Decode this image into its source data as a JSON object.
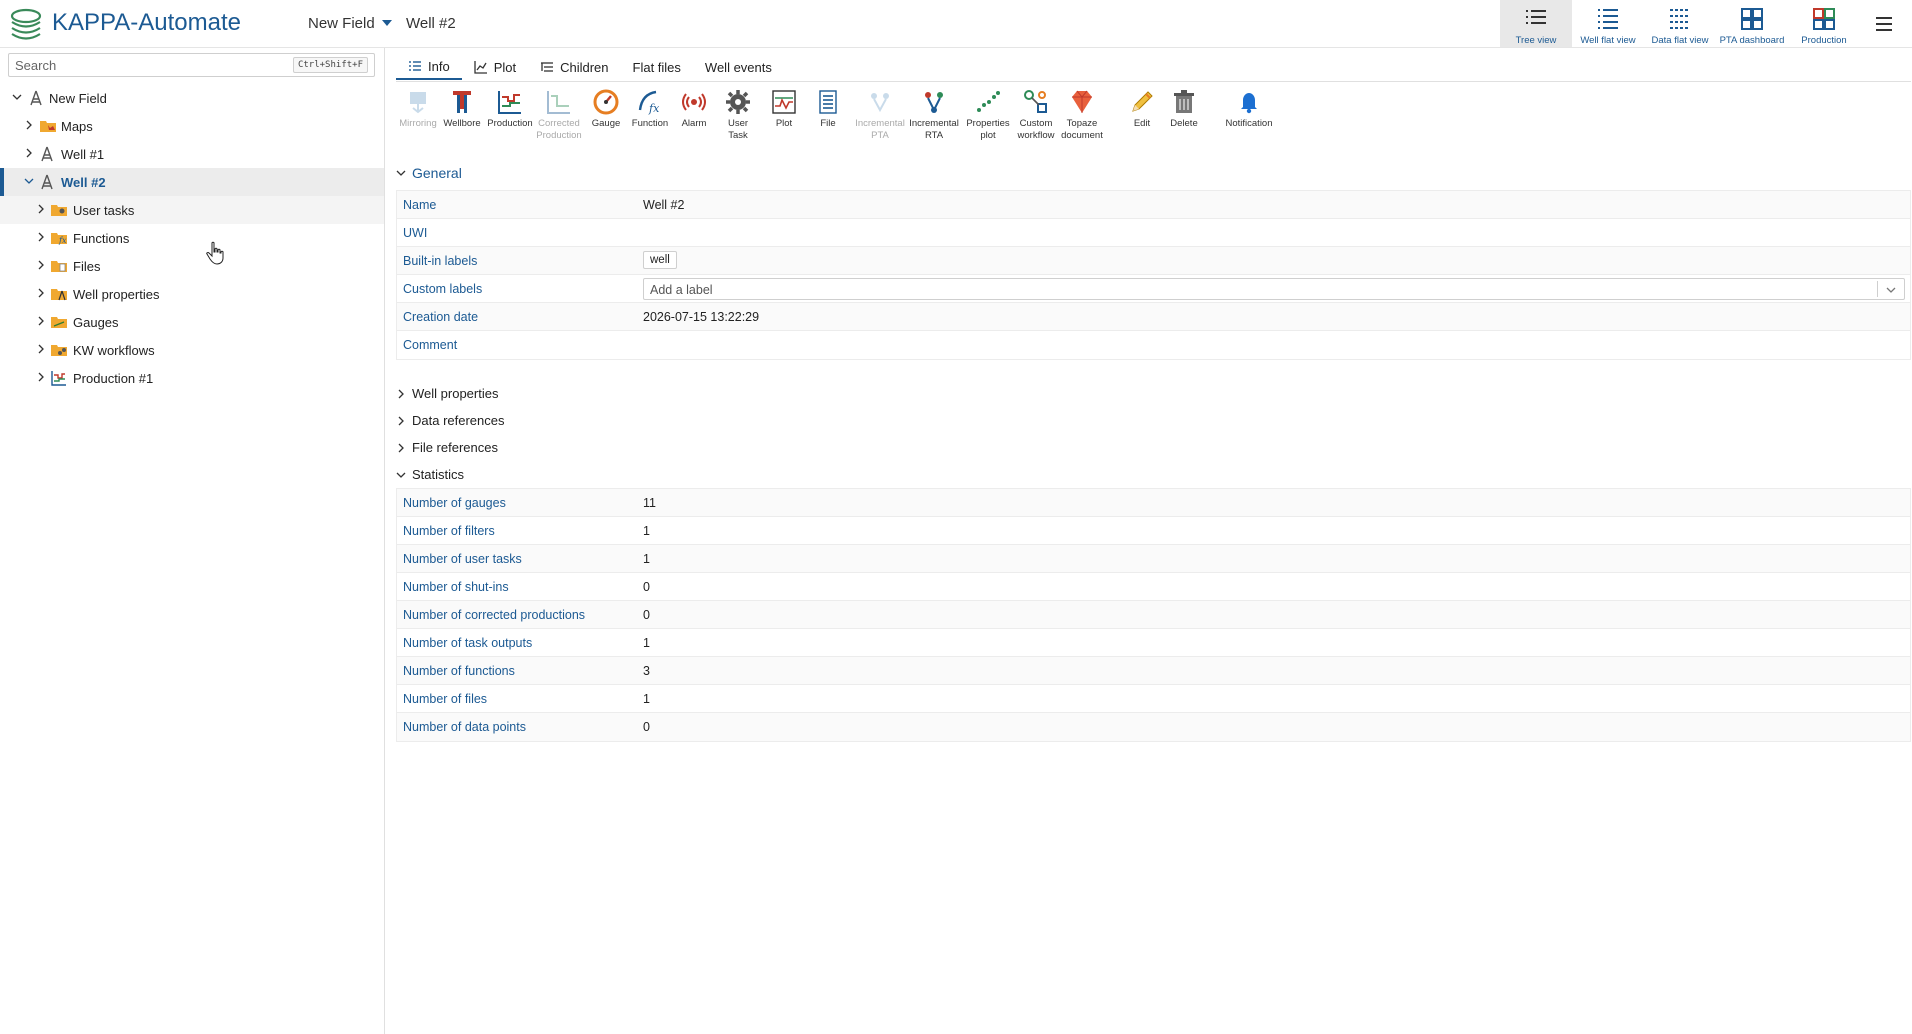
{
  "header": {
    "app_title": "KAPPA-Automate",
    "breadcrumb_field": "New Field",
    "breadcrumb_well": "Well #2",
    "views": [
      {
        "label": "Tree view",
        "icon": "tree-view-icon",
        "active": true
      },
      {
        "label": "Well flat view",
        "icon": "well-flat-view-icon"
      },
      {
        "label": "Data flat view",
        "icon": "data-flat-view-icon"
      },
      {
        "label": "PTA dashboard",
        "icon": "pta-dashboard-icon"
      },
      {
        "label": "Production",
        "icon": "production-dashboard-icon"
      }
    ]
  },
  "sidebar": {
    "search_placeholder": "Search",
    "search_shortcut": "Ctrl+Shift+F",
    "tree": [
      {
        "label": "New Field",
        "icon": "field-icon",
        "level": 0,
        "expanded": true
      },
      {
        "label": "Maps",
        "icon": "maps-folder-icon",
        "level": 1
      },
      {
        "label": "Well #1",
        "icon": "well-icon",
        "level": 1
      },
      {
        "label": "Well #2",
        "icon": "well-icon",
        "level": 1,
        "expanded": true,
        "selected": true
      },
      {
        "label": "User tasks",
        "icon": "user-tasks-folder-icon",
        "level": 2
      },
      {
        "label": "Functions",
        "icon": "functions-folder-icon",
        "level": 2
      },
      {
        "label": "Files",
        "icon": "files-folder-icon",
        "level": 2
      },
      {
        "label": "Well properties",
        "icon": "well-properties-folder-icon",
        "level": 2
      },
      {
        "label": "Gauges",
        "icon": "gauges-folder-icon",
        "level": 2
      },
      {
        "label": "KW workflows",
        "icon": "kw-workflows-folder-icon",
        "level": 2
      },
      {
        "label": "Production #1",
        "icon": "production-icon",
        "level": 2
      }
    ]
  },
  "tabs": [
    {
      "label": "Info",
      "icon": "list-icon",
      "active": true
    },
    {
      "label": "Plot",
      "icon": "chart-icon"
    },
    {
      "label": "Children",
      "icon": "children-icon"
    },
    {
      "label": "Flat files"
    },
    {
      "label": "Well events"
    }
  ],
  "toolbar": [
    {
      "l1": "Mirroring",
      "l2": "",
      "icon": "mirroring-icon",
      "disabled": true
    },
    {
      "l1": "Wellbore",
      "l2": "",
      "icon": "wellbore-icon"
    },
    {
      "l1": "Production",
      "l2": "",
      "icon": "production-icon"
    },
    {
      "l1": "Corrected",
      "l2": "Production",
      "icon": "corrected-production-icon",
      "disabled": true
    },
    {
      "l1": "Gauge",
      "l2": "",
      "icon": "gauge-icon"
    },
    {
      "l1": "Function",
      "l2": "",
      "icon": "function-icon"
    },
    {
      "l1": "Alarm",
      "l2": "",
      "icon": "alarm-icon"
    },
    {
      "l1": "User",
      "l2": "Task",
      "icon": "user-task-icon"
    },
    {
      "l1": "Plot",
      "l2": "",
      "icon": "plot-icon"
    },
    {
      "l1": "File",
      "l2": "",
      "icon": "file-icon"
    },
    {
      "l1": "Incremental",
      "l2": "PTA",
      "icon": "incremental-pta-icon",
      "disabled": true
    },
    {
      "l1": "Incremental",
      "l2": "RTA",
      "icon": "incremental-rta-icon"
    },
    {
      "l1": "Properties",
      "l2": "plot",
      "icon": "properties-plot-icon"
    },
    {
      "l1": "Custom",
      "l2": "workflow",
      "icon": "custom-workflow-icon"
    },
    {
      "l1": "Topaze",
      "l2": "document",
      "icon": "topaze-document-icon"
    },
    {
      "l1": "Edit",
      "l2": "",
      "icon": "edit-icon"
    },
    {
      "l1": "Delete",
      "l2": "",
      "icon": "delete-icon"
    },
    {
      "l1": "Notification",
      "l2": "",
      "icon": "notification-icon"
    }
  ],
  "general": {
    "title": "General",
    "rows": [
      {
        "name": "Name",
        "value": "Well #2"
      },
      {
        "name": "UWI",
        "value": ""
      },
      {
        "name": "Built-in labels",
        "chip": "well"
      },
      {
        "name": "Custom labels",
        "placeholder": "Add a label"
      },
      {
        "name": "Creation date",
        "value": "2026-07-15 13:22:29"
      },
      {
        "name": "Comment",
        "value": ""
      }
    ]
  },
  "collapsed_sections": [
    "Well properties",
    "Data references",
    "File references"
  ],
  "statistics": {
    "title": "Statistics",
    "rows": [
      {
        "name": "Number of gauges",
        "value": "11"
      },
      {
        "name": "Number of filters",
        "value": "1"
      },
      {
        "name": "Number of user tasks",
        "value": "1"
      },
      {
        "name": "Number of shut-ins",
        "value": "0"
      },
      {
        "name": "Number of corrected productions",
        "value": "0"
      },
      {
        "name": "Number of task outputs",
        "value": "1"
      },
      {
        "name": "Number of functions",
        "value": "3"
      },
      {
        "name": "Number of files",
        "value": "1"
      },
      {
        "name": "Number of data points",
        "value": "0"
      }
    ]
  },
  "colors": {
    "accent": "#1c5a93",
    "folder": "#f0a830",
    "selected_bg": "#ececec"
  }
}
